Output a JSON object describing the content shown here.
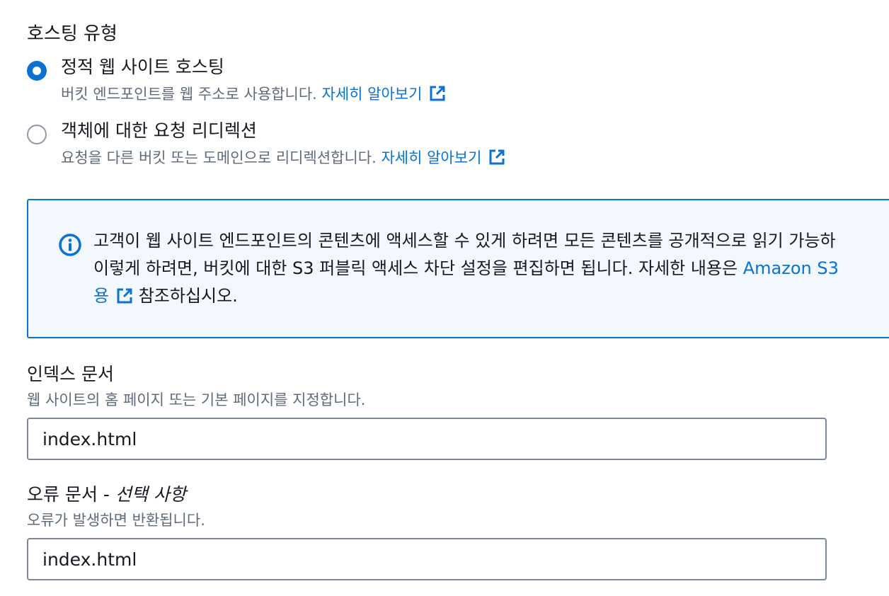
{
  "hosting_type": {
    "title": "호스팅 유형",
    "options": [
      {
        "label": "정적 웹 사이트 호스팅",
        "description": "버킷 엔드포인트를 웹 주소로 사용합니다.",
        "link": "자세히 알아보기",
        "selected": true
      },
      {
        "label": "객체에 대한 요청 리디렉션",
        "description": "요청을 다른 버킷 또는 도메인으로 리디렉션합니다.",
        "link": "자세히 알아보기",
        "selected": false
      }
    ]
  },
  "alert": {
    "line1": "고객이 웹 사이트 엔드포인트의 콘텐츠에 액세스할 수 있게 하려면 모든 콘텐츠를 공개적으로 읽기 가능하",
    "line2_text": "이렇게 하려면, 버킷에 대한 S3 퍼블릭 액세스 차단 설정을 편집하면 됩니다. 자세한 내용은 ",
    "line2_link": "Amazon S3",
    "line3_link": "용",
    "line3_text": " 참조하십시오."
  },
  "index_document": {
    "label": "인덱스 문서",
    "description": "웹 사이트의 홈 페이지 또는 기본 페이지를 지정합니다.",
    "value": "index.html"
  },
  "error_document": {
    "label": "오류 문서 - ",
    "optional": "선택 사항",
    "description": "오류가 발생하면 반환됩니다.",
    "value": "index.html"
  },
  "colors": {
    "accent": "#0972d3",
    "alert_bg": "#f2f8fd",
    "muted_text": "#5f6b7a",
    "text": "#16191f"
  },
  "icons": {
    "external_link": "external-link-icon",
    "info": "info-icon"
  }
}
